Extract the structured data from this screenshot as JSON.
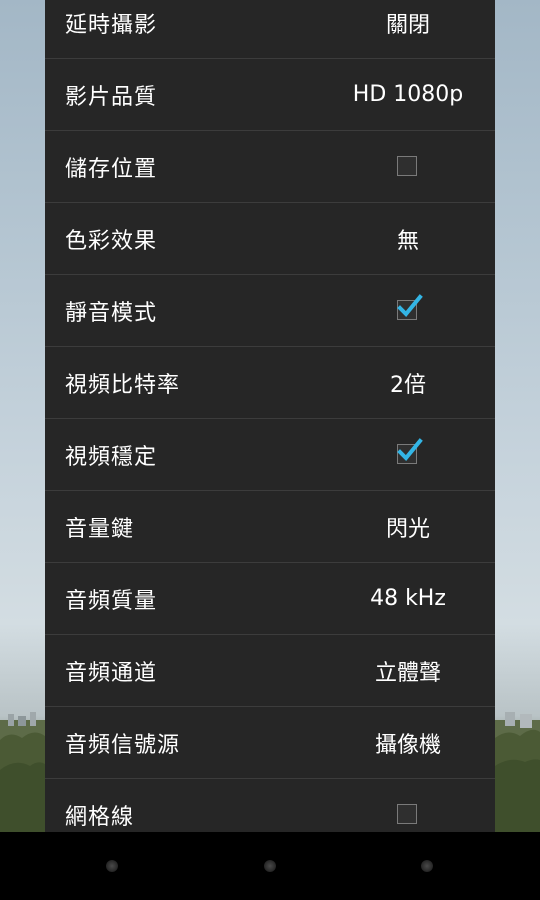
{
  "settings": {
    "items": [
      {
        "label": "延時攝影",
        "type": "value",
        "value": "關閉"
      },
      {
        "label": "影片品質",
        "type": "value",
        "value": "HD 1080p"
      },
      {
        "label": "儲存位置",
        "type": "checkbox",
        "checked": false
      },
      {
        "label": "色彩效果",
        "type": "value",
        "value": "無"
      },
      {
        "label": "靜音模式",
        "type": "checkbox",
        "checked": true
      },
      {
        "label": "視頻比特率",
        "type": "value",
        "value": "2倍"
      },
      {
        "label": "視頻穩定",
        "type": "checkbox",
        "checked": true
      },
      {
        "label": "音量鍵",
        "type": "value",
        "value": "閃光"
      },
      {
        "label": "音頻質量",
        "type": "value",
        "value": "48 kHz"
      },
      {
        "label": "音頻通道",
        "type": "value",
        "value": "立體聲"
      },
      {
        "label": "音頻信號源",
        "type": "value",
        "value": "攝像機"
      },
      {
        "label": "網格線",
        "type": "checkbox",
        "checked": false
      }
    ]
  },
  "colors": {
    "panel_bg": "#262626",
    "divider": "#3c3c3c",
    "text": "#ffffff",
    "check_accent": "#33b5e5"
  },
  "navigation": {
    "buttons": [
      "back-button",
      "home-button",
      "recents-button"
    ]
  }
}
